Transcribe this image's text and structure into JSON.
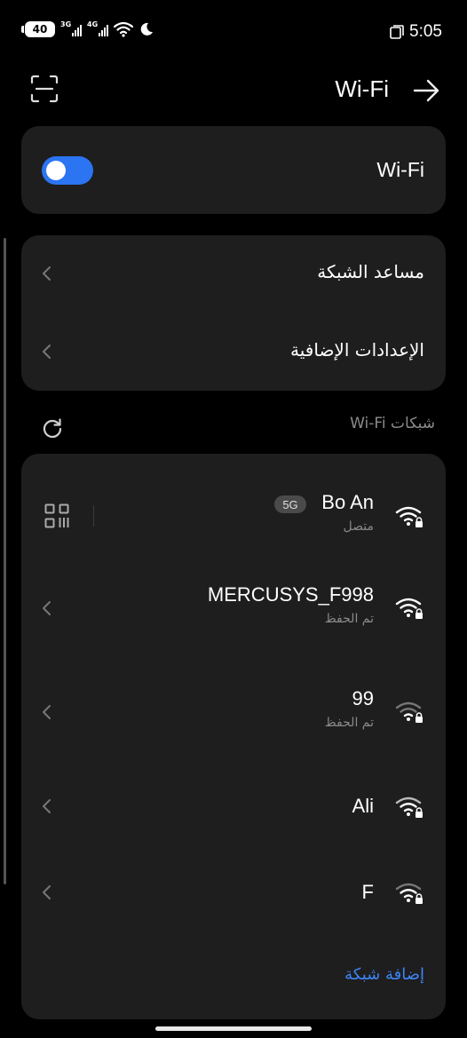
{
  "status_bar": {
    "battery": "40",
    "network_1": "3G",
    "network_2": "4G",
    "time": "5:05"
  },
  "header": {
    "title": "Wi-Fi"
  },
  "wifi_toggle": {
    "label": "Wi-Fi",
    "enabled": true,
    "accent_color": "#2b74f2"
  },
  "settings_rows": [
    {
      "label": "مساعد الشبكة"
    },
    {
      "label": "الإعدادات الإضافية"
    }
  ],
  "networks_section": {
    "title": "شبكات Wi-Fi"
  },
  "networks": [
    {
      "name": "Bo An",
      "badge": "5G",
      "status": "متصل",
      "icon": "wifi-lock-icon"
    },
    {
      "name": "MERCUSYS_F998",
      "status": "تم الحفظ",
      "icon": "wifi-lock-icon"
    },
    {
      "name": "99",
      "status": "تم الحفظ",
      "icon": "wifi-lock-icon"
    },
    {
      "name": "Ali",
      "status": "",
      "icon": "wifi-lock-icon"
    },
    {
      "name": "F",
      "status": "",
      "icon": "wifi-lock-icon"
    }
  ],
  "add_network": {
    "label": "إضافة شبكة",
    "color": "#3d84f5"
  }
}
